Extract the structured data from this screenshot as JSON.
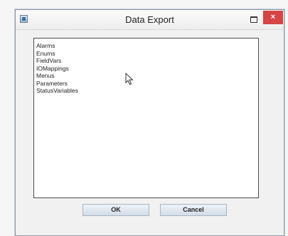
{
  "window": {
    "title": "Data Export",
    "close_glyph": "×",
    "icons": [
      "app-icon",
      "restore-icon",
      "close-icon",
      "cursor-icon"
    ]
  },
  "list": {
    "items": [
      "Alarms",
      "Enums",
      "FieldVars",
      "IOMappings",
      "Menus",
      "Parameters",
      "StatusVariables"
    ]
  },
  "buttons": {
    "ok_label": "OK",
    "cancel_label": "Cancel"
  },
  "colors": {
    "close_button": "#d64545",
    "button_face": "#d3dce7",
    "list_background": "#ffffff"
  }
}
